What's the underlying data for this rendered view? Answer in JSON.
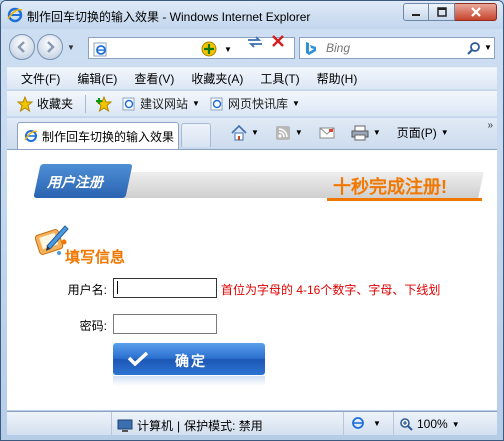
{
  "window": {
    "title": "制作回车切换的输入效果 - Windows Internet Explorer"
  },
  "search": {
    "placeholder": "Bing"
  },
  "menu": [
    "文件(F)",
    "编辑(E)",
    "查看(V)",
    "收藏夹(A)",
    "工具(T)",
    "帮助(H)"
  ],
  "favorites": {
    "label": "收藏夹",
    "links": [
      "建议网站",
      "网页快讯库"
    ]
  },
  "tab": {
    "label": "制作回车切换的输入效果"
  },
  "commands": {
    "page": "页面(P)"
  },
  "page": {
    "banner_tab": "用户注册",
    "banner_slogan": "十秒完成注册!",
    "section_title": "填写信息",
    "username_label": "用户名:",
    "username_value": "",
    "username_hint": "首位为字母的 4-16个数字、字母、下线划",
    "password_label": "密码:",
    "password_value": "",
    "submit_label": "确定"
  },
  "status": {
    "zone": "计算机",
    "protected_mode": "保护模式: 禁用",
    "zoom": "100%"
  },
  "colors": {
    "accent_orange": "#f07800",
    "hint_red": "#e00000",
    "button_blue": "#2b6fcf"
  }
}
